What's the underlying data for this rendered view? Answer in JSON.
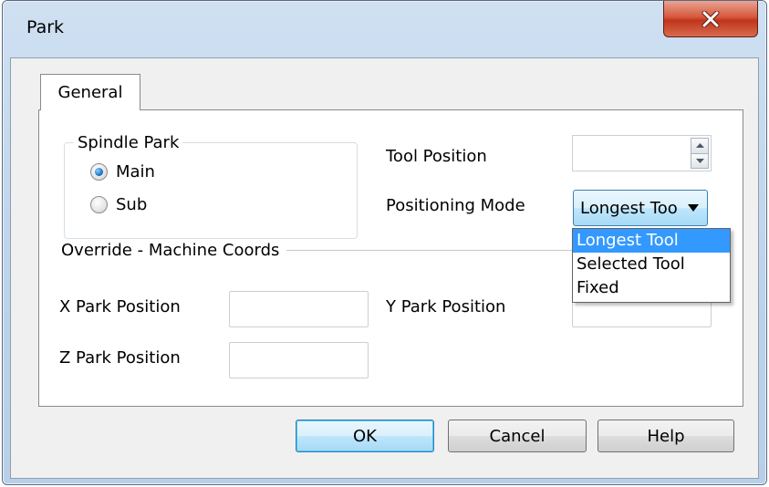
{
  "window": {
    "title": "Park"
  },
  "tabs": [
    {
      "label": "General"
    }
  ],
  "spindle_park": {
    "legend": "Spindle Park",
    "options": [
      {
        "label": "Main",
        "checked": true
      },
      {
        "label": "Sub",
        "checked": false
      }
    ]
  },
  "tool_position": {
    "label": "Tool Position",
    "value": ""
  },
  "positioning_mode": {
    "label": "Positioning Mode",
    "selected": "Longest Tool",
    "options": [
      "Longest Tool",
      "Selected Tool",
      "Fixed"
    ]
  },
  "override": {
    "legend": "Override - Machine Coords",
    "x_label": "X Park Position",
    "y_label": "Y Park Position",
    "z_label": "Z Park Position",
    "x_value": "",
    "y_value": "",
    "z_value": ""
  },
  "buttons": {
    "ok": "OK",
    "cancel": "Cancel",
    "help": "Help"
  },
  "colors": {
    "selection": "#3399ff",
    "close_red": "#c7452a",
    "frame": "#bcd3ea"
  },
  "icons": {
    "close": "close-icon",
    "dropdown": "chevron-down-icon",
    "spin_up": "arrow-up-icon",
    "spin_down": "arrow-down-icon"
  }
}
